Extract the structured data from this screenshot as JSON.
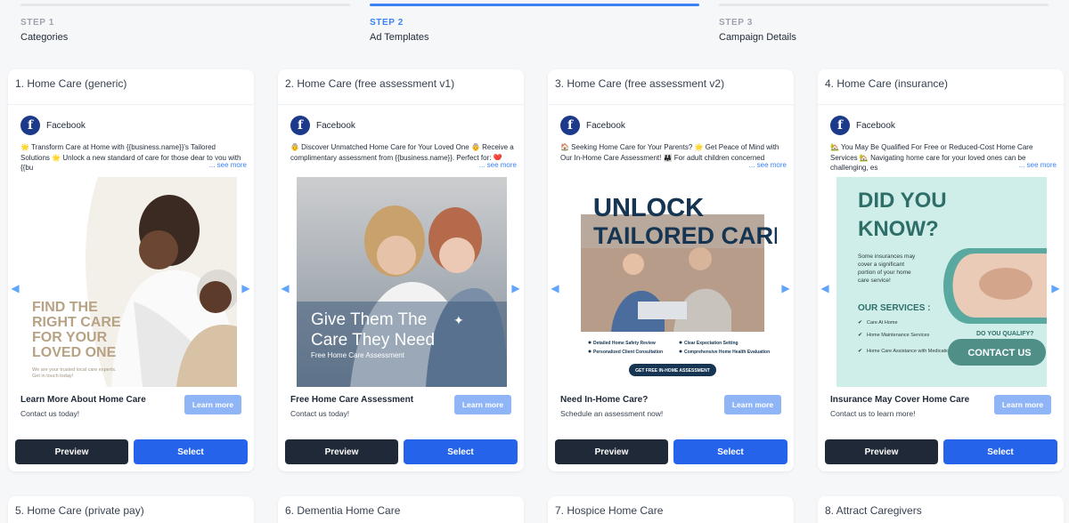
{
  "steps": [
    {
      "num": "STEP 1",
      "label": "Categories"
    },
    {
      "num": "STEP 2",
      "label": "Ad Templates"
    },
    {
      "num": "STEP 3",
      "label": "Campaign Details"
    }
  ],
  "cards": [
    {
      "title": "1. Home Care (generic)",
      "platform": "Facebook",
      "ad_text": "🌟 Transform Care at Home with {{business.name}}'s Tailored Solutions 🌟  Unlock a new standard of care for those dear to you with {{bu",
      "see_more": "... see more",
      "image_text": {
        "headline": [
          "FIND THE",
          "RIGHT CARE",
          "FOR YOUR",
          "LOVED ONE"
        ],
        "sub": [
          "We are your trusted local care experts.",
          "Get in touch today!"
        ]
      },
      "footer_title": "Learn More About Home Care",
      "footer_sub": "Contact us today!",
      "learn_label": "Learn more",
      "preview_label": "Preview",
      "select_label": "Select"
    },
    {
      "title": "2. Home Care (free assessment v1)",
      "platform": "Facebook",
      "ad_text": "👵 Discover Unmatched Home Care for Your Loved One 👵  Receive a complimentary assessment from {{business.name}}. Perfect for: ❤️",
      "see_more": "... see more",
      "image_text": {
        "headline": [
          "Give Them The",
          "Care They Need"
        ],
        "sub": [
          "Free Home Care Assessment"
        ]
      },
      "footer_title": "Free Home Care Assessment",
      "footer_sub": "Contact us today!",
      "learn_label": "Learn more",
      "preview_label": "Preview",
      "select_label": "Select"
    },
    {
      "title": "3. Home Care (free assessment v2)",
      "platform": "Facebook",
      "ad_text": "🏠 Seeking Home Care for Your Parents? 🌟 Get Peace of Mind with Our In-Home Care Assessment! 👨‍👩‍👧 For adult children concerned",
      "see_more": "... see more",
      "image_text": {
        "headline": [
          "UNLOCK",
          "TAILORED CARE"
        ],
        "bullets": [
          "Detailed Home Safety Review",
          "Clear Expectation Setting",
          "Personalized Client Consultation",
          "Comprehensive Home Health Evaluation"
        ],
        "cta": "GET FREE IN-HOME ASSESSMENT"
      },
      "footer_title": "Need In-Home Care?",
      "footer_sub": "Schedule an assessment now!",
      "learn_label": "Learn more",
      "preview_label": "Preview",
      "select_label": "Select"
    },
    {
      "title": "4. Home Care (insurance)",
      "platform": "Facebook",
      "ad_text": "🏡 You May Be Qualified For Free or Reduced-Cost Home Care Services 🏡  Navigating home care for your loved ones can be challenging, es",
      "see_more": "... see more",
      "image_text": {
        "headline": [
          "DID YOU",
          "KNOW?"
        ],
        "body": [
          "Some insurances may",
          "cover a significant",
          "portion of your home",
          "care service!"
        ],
        "services_title": "OUR SERVICES :",
        "services": [
          "Care At Home",
          "Home Maintenance Services",
          "Home Care Assistance with Medications"
        ],
        "question": "DO YOU QUALIFY?",
        "cta": "CONTACT US"
      },
      "footer_title": "Insurance May Cover Home Care",
      "footer_sub": "Contact us to learn more!",
      "learn_label": "Learn more",
      "preview_label": "Preview",
      "select_label": "Select"
    }
  ],
  "next_cards": [
    {
      "title": "5. Home Care (private pay)"
    },
    {
      "title": "6. Dementia Home Care"
    },
    {
      "title": "7. Hospice Home Care"
    },
    {
      "title": "8. Attract Caregivers"
    }
  ],
  "colors": {
    "accent": "#3b82f6",
    "select_button": "#2563eb",
    "preview_button": "#1f2937",
    "learn_button": "#8fb5f7",
    "facebook": "#1d3a8a"
  }
}
